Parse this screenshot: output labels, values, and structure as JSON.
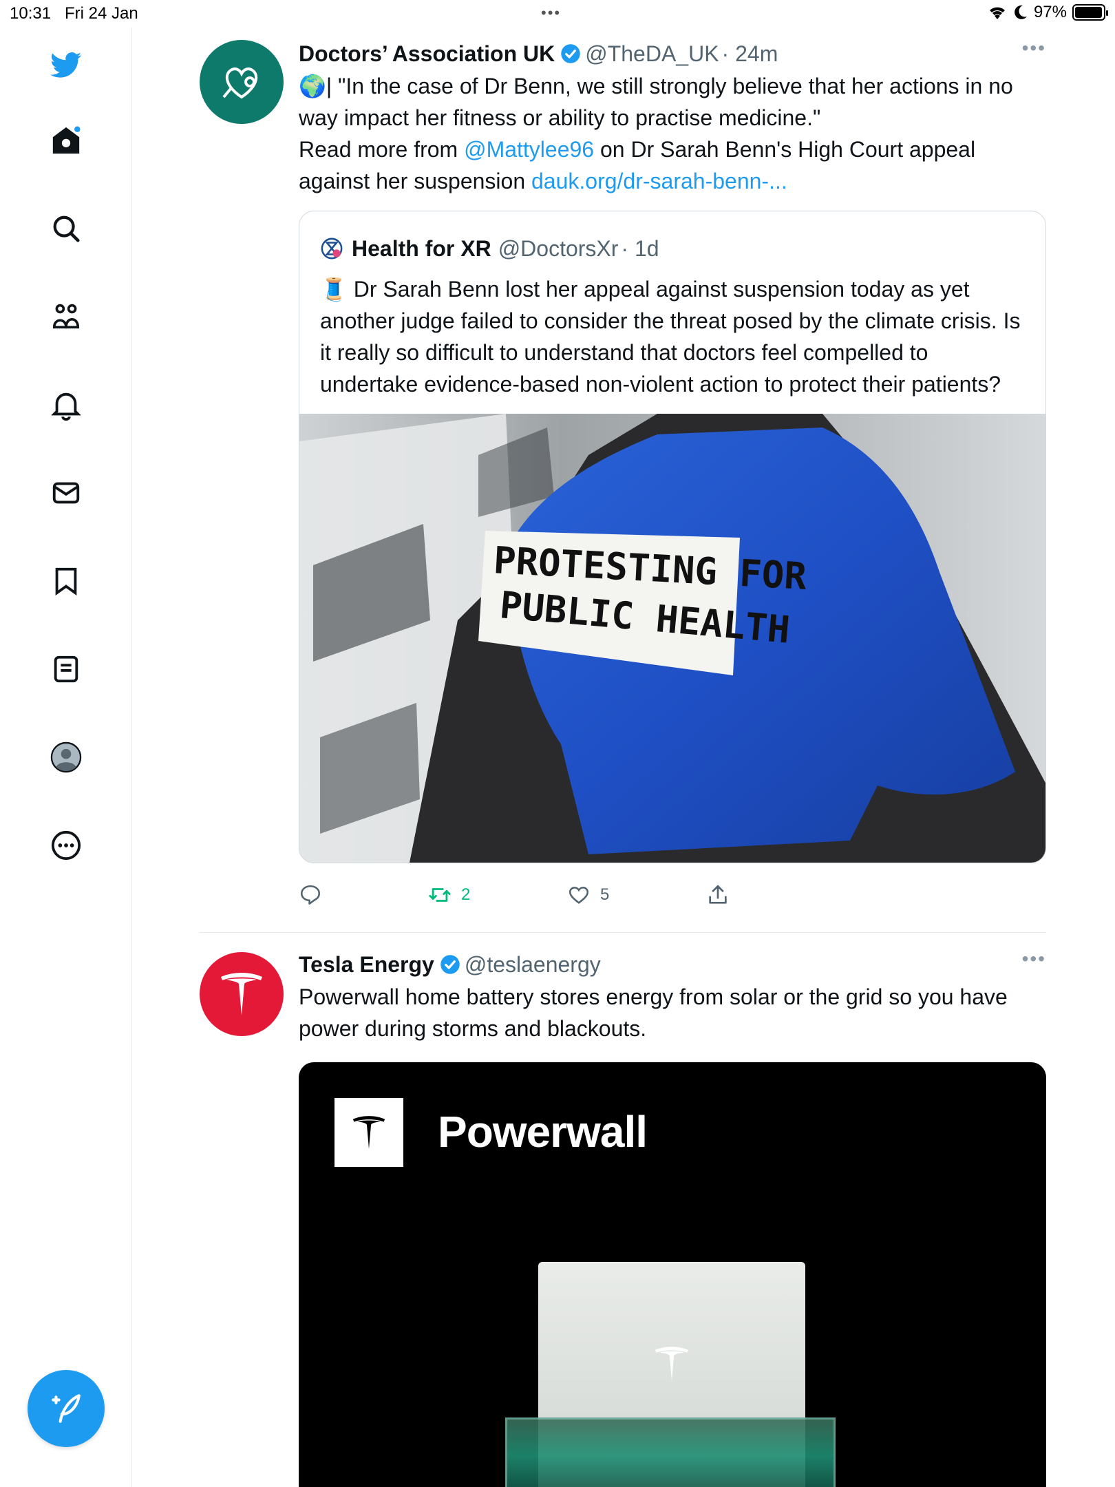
{
  "status_bar": {
    "time": "10:31",
    "date": "Fri 24 Jan",
    "battery_pct": "97%"
  },
  "sidebar": {
    "items": [
      {
        "name": "twitter-logo-icon"
      },
      {
        "name": "home-icon"
      },
      {
        "name": "search-icon"
      },
      {
        "name": "communities-icon"
      },
      {
        "name": "notifications-icon"
      },
      {
        "name": "messages-icon"
      },
      {
        "name": "bookmarks-icon"
      },
      {
        "name": "lists-icon"
      },
      {
        "name": "profile-icon"
      },
      {
        "name": "more-icon"
      }
    ],
    "compose_label": "+"
  },
  "tweets": [
    {
      "name": "Doctors’ Association UK",
      "handle": "@TheDA_UK",
      "time": "· 24m",
      "more": "•••",
      "text_prefix": "🌍| \"In the case of Dr Benn, we still strongly believe that her actions in no way impact her fitness or ability to practise medicine.\"",
      "text_read_more": "Read more from ",
      "mention": "@Mattylee96",
      "text_middle": " on Dr Sarah Benn's High Court appeal against her suspension ",
      "link": "dauk.org/dr-sarah-benn-...",
      "quote": {
        "name": "Health for XR",
        "handle": "@DoctorsXr",
        "time": "· 1d",
        "text": "🧵 Dr Sarah Benn lost her appeal against suspension  today as yet another judge failed to consider the threat posed by the climate crisis. Is it really so difficult to understand that doctors feel compelled to undertake evidence-based non-violent action to protect their patients?",
        "image_sign_line1": "PROTESTING FOR",
        "image_sign_line2": "PUBLIC HEALTH"
      },
      "retweets": "2",
      "likes": "5",
      "colors": {
        "avatar_bg": "#0e7a6c"
      }
    },
    {
      "name": "Tesla Energy",
      "handle": "@teslaenergy",
      "more": "•••",
      "text": "Powerwall home battery stores energy from solar or the grid so you have power during storms and blackouts.",
      "card_title": "Powerwall",
      "colors": {
        "avatar_bg": "#e31937"
      }
    }
  ],
  "colors": {
    "accent": "#1d9bf0",
    "retweet": "#00ba7c",
    "muted": "#536471"
  }
}
